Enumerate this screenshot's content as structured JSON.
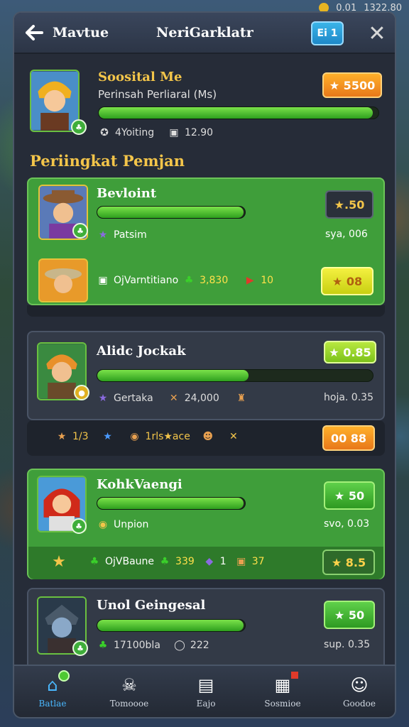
{
  "topbar": {
    "value1": "0.01",
    "value2": "1322.80"
  },
  "header": {
    "back_label": "Mavtue",
    "title": "NeriGarklatr",
    "action_label": "Ei 1"
  },
  "me": {
    "name": "Soosital Me",
    "subtitle": "Perinsah Perliaral (Ms)",
    "score": "★ 5500",
    "progress": 0.98,
    "stat1": "4Yoiting",
    "stat2": "12.90"
  },
  "section_title": "Periingkat Pemjan",
  "players": [
    {
      "name": "Bevloint",
      "progress": 0.99,
      "score": "★.50",
      "rank_label": "Patsim",
      "right_value": "sya, 006",
      "sub_row": {
        "label": "OjVarntitiano",
        "value1": "3,830",
        "value2": "10",
        "button": "★ 08"
      }
    },
    {
      "name": "Alidc Jockak",
      "progress": 0.55,
      "score": "★ 0.85",
      "rank_label": "Gertaka",
      "stat_value": "24,000",
      "right_value": "hoja. 0.35",
      "sub_row": {
        "label1": "1/3",
        "label2": "1rls★ace",
        "button": "00 88"
      }
    },
    {
      "name": "KohkVaengi",
      "progress": 0.99,
      "score": "★ 50",
      "rank_label": "Unpion",
      "right_value": "svo, 0.03",
      "sub_row": {
        "label": "OjVBaune",
        "value1": "339",
        "value2": "1",
        "value3": "37",
        "button": "★ 8.5"
      }
    },
    {
      "name": "Unol Geingesal",
      "progress": 0.99,
      "score": "★ 50",
      "stat1": "17100bla",
      "stat2": "222",
      "right_value": "sup. 0.35"
    }
  ],
  "nav": [
    {
      "label": "Batlae",
      "icon": "home-icon"
    },
    {
      "label": "Tomoooe",
      "icon": "skull-icon"
    },
    {
      "label": "Eajo",
      "icon": "map-icon"
    },
    {
      "label": "Sosmioe",
      "icon": "chart-icon"
    },
    {
      "label": "Goodoe",
      "icon": "profile-icon"
    }
  ],
  "colors": {
    "accent": "#f3c54a",
    "green": "#3f9e3a",
    "panel": "#262c38",
    "nav_active": "#4ab8ff"
  }
}
